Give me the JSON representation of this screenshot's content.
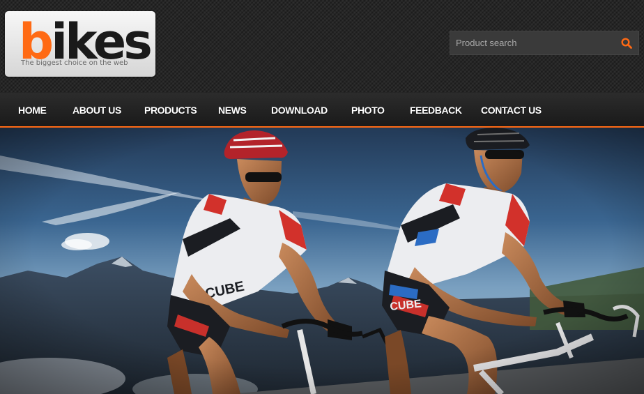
{
  "logo": {
    "letter_accent": "b",
    "letters_rest": "ikes",
    "tagline": "The biggest choice on the web",
    "accent_color": "#ff6a14"
  },
  "search": {
    "placeholder": "Product search",
    "icon": "search-icon"
  },
  "nav": {
    "items": [
      {
        "label": "HOME"
      },
      {
        "label": "ABOUT US"
      },
      {
        "label": "PRODUCTS"
      },
      {
        "label": "NEWS"
      },
      {
        "label": "DOWNLOAD"
      },
      {
        "label": "PHOTO"
      },
      {
        "label": "FEEDBACK"
      },
      {
        "label": "CONTACT US"
      }
    ],
    "accent_color": "#ff6a14"
  },
  "hero": {
    "image": "hero-cyclists-photo",
    "jersey_text": "CUBE"
  }
}
